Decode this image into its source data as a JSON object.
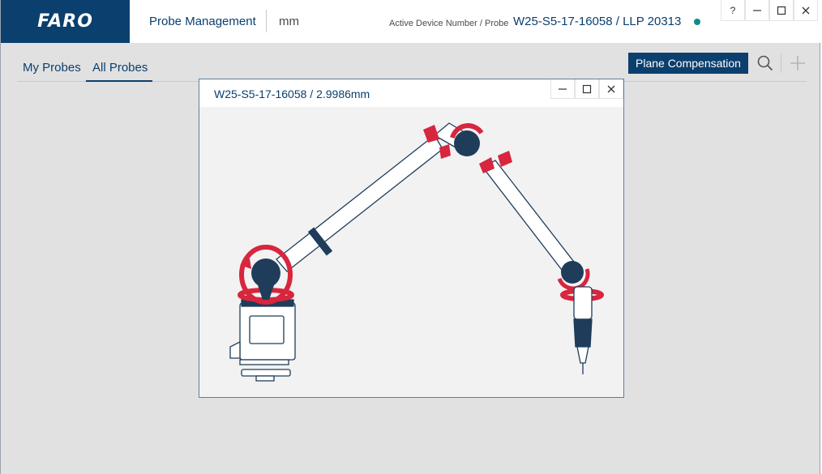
{
  "app": {
    "logo_text": "FARO",
    "title": "Probe Management",
    "unit": "mm",
    "active_label": "Active Device Number / Probe",
    "active_value": "W25-S5-17-16058 / LLP 20313",
    "status_color": "#138a85"
  },
  "window_controls": {
    "help": "?",
    "minimize": "–",
    "maximize": "□",
    "close": "✕"
  },
  "tabs": [
    {
      "label": "My Probes",
      "active": false
    },
    {
      "label": "All Probes",
      "active": true
    }
  ],
  "toolbar": {
    "plane_compensation_label": "Plane Compensation",
    "search_icon": "search-icon",
    "add_icon": "plus-icon"
  },
  "dialog": {
    "title": "W25-S5-17-16058 / 2.9986mm",
    "minimize": "–",
    "maximize": "□",
    "close": "✕",
    "illustration": "faro-arm-rotation-diagram"
  },
  "colors": {
    "brand": "#0b3f6e",
    "accent_red": "#d7263d",
    "joint_dark": "#1f3d5a",
    "background": "#e1e1e1"
  }
}
